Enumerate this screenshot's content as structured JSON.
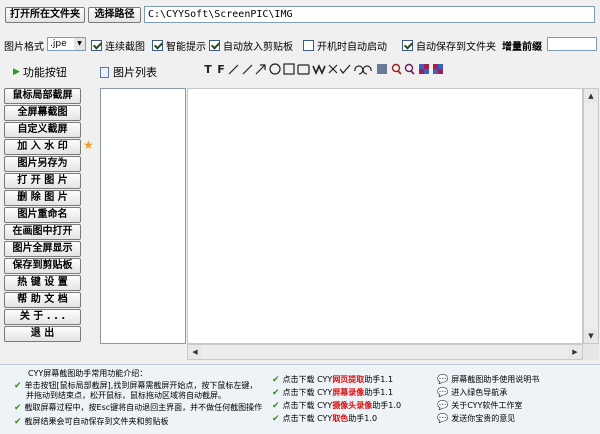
{
  "toolbar": {
    "open_folder_label": "打开所在文件夹",
    "choose_path_label": "选择路径",
    "path_value": "C:\\CYYSoft\\ScreenPIC\\IMG"
  },
  "options": {
    "format_label": "图片格式",
    "format_value": ".jpe",
    "continuous": "连续截图",
    "smart_tip": "智能提示",
    "auto_clipboard": "自动放入剪贴板",
    "startup": "开机时自动启动",
    "auto_save": "自动保存到文件夹",
    "increment_label": "增量前缀",
    "increment_value": ""
  },
  "tabs": {
    "functions": "功能按钮",
    "image_list": "图片列表"
  },
  "tools": [
    "T",
    "F"
  ],
  "side_buttons": [
    "鼠标局部截屏",
    "全屏幕截图",
    "自定义截屏",
    "加 入 水 印",
    "图片另存为",
    "打 开 图 片",
    "删 除 图 片",
    "图片重命名",
    "在画图中打开",
    "图片全屏显示",
    "保存到剪贴板",
    "热 键 设 置",
    "帮 助 文 档",
    "关 于 . . .",
    "退     出"
  ],
  "bottom": {
    "intro": "CYY屏幕截图助手常用功能介绍：",
    "tip1_line1": "单击按钮[鼠标局部截屏],找到屏幕需截屏开始点，按下鼠标左键，",
    "tip1_line2": "并拖动到结束点，松开鼠标，鼠标拖动区域将自动截屏。",
    "tip2": "截取屏幕过程中，按Esc键将自动退回主界面，并不做任何截图操作",
    "tip3": "截屏结果会可自动保存到文件夹和剪贴板",
    "downloads": [
      {
        "prefix": "点击下载 CYY",
        "name": "网页提取",
        "suffix": "助手1.1"
      },
      {
        "prefix": "点击下载 CYY",
        "name": "屏幕录像",
        "suffix": "助手1.1"
      },
      {
        "prefix": "点击下载 CYY",
        "name": "摄像头录像",
        "suffix": "助手1.0"
      },
      {
        "prefix": "点击下载 CYY",
        "name": "取色",
        "suffix": "助手1.0"
      }
    ],
    "links": [
      "屏幕截图助手使用说明书",
      "进入绿色导航承",
      "关于CYY软件工作室",
      "发送你宝贵的意见"
    ]
  }
}
